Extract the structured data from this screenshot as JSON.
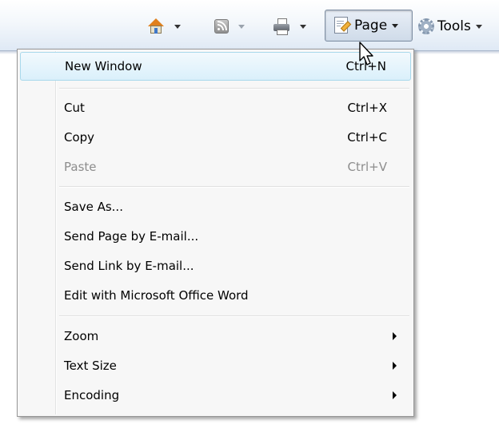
{
  "toolbar": {
    "home_icon": "home-icon",
    "feeds_icon": "feeds-icon",
    "print_icon": "print-icon",
    "page_label": "Page",
    "page_icon": "page-icon",
    "tools_label": "Tools",
    "tools_icon": "gear-icon"
  },
  "menu": {
    "items": [
      {
        "label": "New Window",
        "shortcut": "Ctrl+N",
        "highlighted": true
      },
      {
        "label": "Cut",
        "shortcut": "Ctrl+X"
      },
      {
        "label": "Copy",
        "shortcut": "Ctrl+C"
      },
      {
        "label": "Paste",
        "shortcut": "Ctrl+V",
        "disabled": true
      },
      {
        "label": "Save As..."
      },
      {
        "label": "Send Page by E-mail..."
      },
      {
        "label": "Send Link by E-mail..."
      },
      {
        "label": "Edit with Microsoft Office Word"
      },
      {
        "label": "Zoom",
        "submenu": true
      },
      {
        "label": "Text Size",
        "submenu": true
      },
      {
        "label": "Encoding",
        "submenu": true
      }
    ]
  },
  "colors": {
    "highlight_border": "#a8d8eb",
    "highlight_fill": "#daf0fb",
    "disabled_text": "#8d8d8d"
  }
}
